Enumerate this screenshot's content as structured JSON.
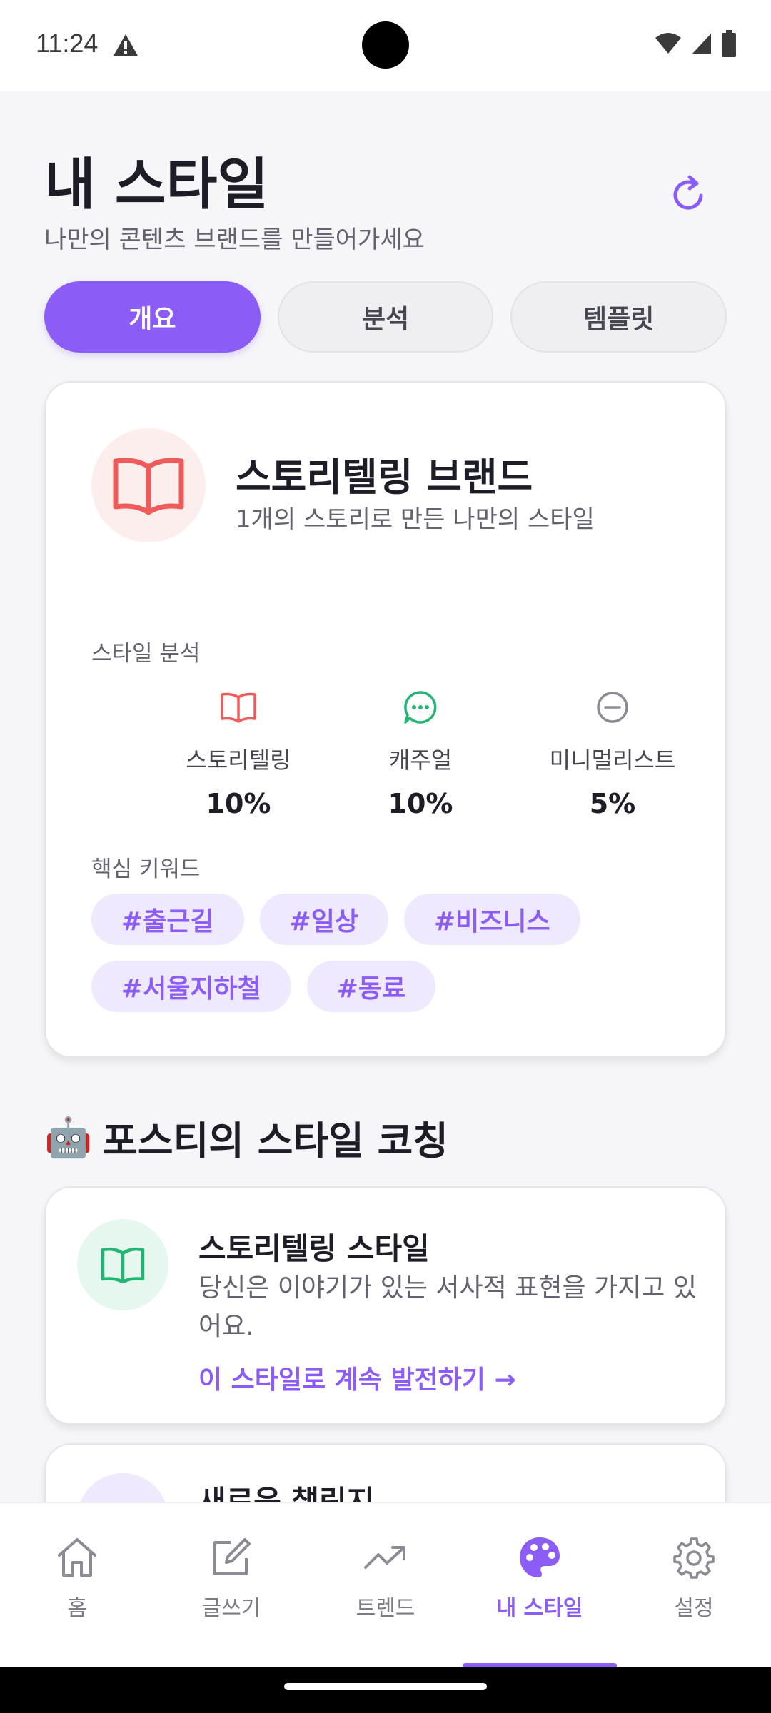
{
  "status_bar": {
    "time": "11:24"
  },
  "header": {
    "title": "내 스타일",
    "subtitle": "나만의 콘텐츠 브랜드를 만들어가세요"
  },
  "tabs": [
    {
      "label": "개요",
      "active": true
    },
    {
      "label": "분석",
      "active": false
    },
    {
      "label": "템플릿",
      "active": false
    }
  ],
  "brand_card": {
    "title": "스토리텔링 브랜드",
    "description": "1개의 스토리로 만든 나만의 스타일",
    "analysis_label": "스타일 분석",
    "stats": [
      {
        "label": "스토리텔링",
        "value": "10%",
        "icon": "book-icon",
        "color": "#ef5b5b"
      },
      {
        "label": "캐주얼",
        "value": "10%",
        "icon": "chat-bubble-icon",
        "color": "#22b573"
      },
      {
        "label": "미니멀리스트",
        "value": "5%",
        "icon": "minus-circle-icon",
        "color": "#8a8b94"
      }
    ],
    "keywords_label": "핵심 키워드",
    "keywords": [
      "#출근길",
      "#일상",
      "#비즈니스",
      "#서울지하철",
      "#동료"
    ]
  },
  "coaching": {
    "title": "포스티의 스타일 코칭",
    "emoji": "🤖",
    "cards": [
      {
        "title": "스토리텔링 스타일",
        "description": "당신은 이야기가 있는 서사적 표현을 가지고 있어요.",
        "link": "이 스타일로 계속 발전하기 →"
      },
      {
        "title": "새로운 챌린지"
      }
    ]
  },
  "bottom_nav": [
    {
      "label": "홈",
      "icon": "home-icon"
    },
    {
      "label": "글쓰기",
      "icon": "edit-icon"
    },
    {
      "label": "트렌드",
      "icon": "trending-icon"
    },
    {
      "label": "내 스타일",
      "icon": "palette-icon",
      "active": true
    },
    {
      "label": "설정",
      "icon": "gear-icon"
    }
  ],
  "colors": {
    "accent": "#8b5cf6",
    "accent_light": "#efe9fd",
    "story_red": "#ef5b5b",
    "casual_green": "#22b573"
  }
}
